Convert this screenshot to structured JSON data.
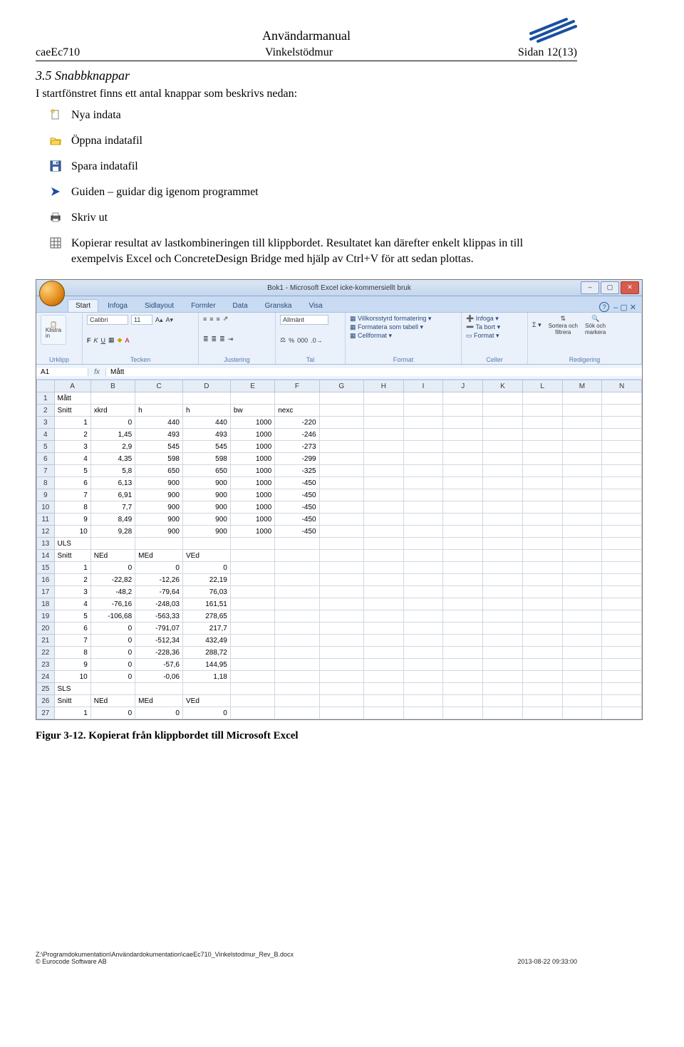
{
  "header": {
    "doc_title": "Användarmanual",
    "left": "caeEc710",
    "center": "Vinkelstödmur",
    "right": "Sidan 12(13)"
  },
  "section": {
    "heading": "3.5  Snabbknappar",
    "intro": "I startfönstret finns ett antal knappar som beskrivs nedan:",
    "items": [
      {
        "icon": "new-file-icon",
        "text": "Nya indata"
      },
      {
        "icon": "open-file-icon",
        "text": "Öppna indatafil"
      },
      {
        "icon": "save-icon",
        "text": "Spara indatafil"
      },
      {
        "icon": "guide-arrow-icon",
        "text": "Guiden – guidar dig igenom programmet"
      },
      {
        "icon": "print-icon",
        "text": "Skriv ut"
      },
      {
        "icon": "grid-icon",
        "text": "Kopierar resultat av lastkombineringen till klippbordet. Resultatet kan därefter enkelt klippas in till exempelvis Excel och ConcreteDesign Bridge med hjälp av Ctrl+V för att sedan plottas."
      }
    ]
  },
  "excel": {
    "title": "Bok1 - Microsoft Excel icke-kommersiellt bruk",
    "tabs": [
      "Start",
      "Infoga",
      "Sidlayout",
      "Formler",
      "Data",
      "Granska",
      "Visa"
    ],
    "active_tab": "Start",
    "ribbon": {
      "urklipp": {
        "label": "Urklipp",
        "paste": "Klistra\nin"
      },
      "tecken": {
        "label": "Tecken",
        "font": "Calibri",
        "size": "11"
      },
      "justering": {
        "label": "Justering"
      },
      "tal": {
        "label": "Tal",
        "format": "Allmänt"
      },
      "format": {
        "label": "Format",
        "items": [
          "Villkorsstyrd formatering",
          "Formatera som tabell",
          "Cellformat"
        ]
      },
      "celler": {
        "label": "Celler",
        "items": [
          "Infoga",
          "Ta bort",
          "Format"
        ]
      },
      "redigering": {
        "label": "Redigering",
        "sort": "Sortera och\nfiltrera",
        "find": "Sök och\nmarkera"
      }
    },
    "namebox": "A1",
    "formula": "Mått",
    "columns": [
      "A",
      "B",
      "C",
      "D",
      "E",
      "F",
      "G",
      "H",
      "I",
      "J",
      "K",
      "L",
      "M",
      "N"
    ],
    "rows": [
      {
        "n": 1,
        "cells": [
          "Mått",
          "",
          "",
          "",
          "",
          "",
          "",
          "",
          "",
          "",
          "",
          "",
          "",
          ""
        ],
        "txt": [
          0
        ]
      },
      {
        "n": 2,
        "cells": [
          "Snitt",
          "xkrd",
          "h",
          "h",
          "bw",
          "nexc",
          "",
          "",
          "",
          "",
          "",
          "",
          "",
          ""
        ],
        "txt": [
          0,
          1,
          2,
          3,
          4,
          5
        ]
      },
      {
        "n": 3,
        "cells": [
          "1",
          "0",
          "440",
          "440",
          "1000",
          "-220",
          "",
          "",
          "",
          "",
          "",
          "",
          "",
          ""
        ]
      },
      {
        "n": 4,
        "cells": [
          "2",
          "1,45",
          "493",
          "493",
          "1000",
          "-246",
          "",
          "",
          "",
          "",
          "",
          "",
          "",
          ""
        ]
      },
      {
        "n": 5,
        "cells": [
          "3",
          "2,9",
          "545",
          "545",
          "1000",
          "-273",
          "",
          "",
          "",
          "",
          "",
          "",
          "",
          ""
        ]
      },
      {
        "n": 6,
        "cells": [
          "4",
          "4,35",
          "598",
          "598",
          "1000",
          "-299",
          "",
          "",
          "",
          "",
          "",
          "",
          "",
          ""
        ]
      },
      {
        "n": 7,
        "cells": [
          "5",
          "5,8",
          "650",
          "650",
          "1000",
          "-325",
          "",
          "",
          "",
          "",
          "",
          "",
          "",
          ""
        ]
      },
      {
        "n": 8,
        "cells": [
          "6",
          "6,13",
          "900",
          "900",
          "1000",
          "-450",
          "",
          "",
          "",
          "",
          "",
          "",
          "",
          ""
        ]
      },
      {
        "n": 9,
        "cells": [
          "7",
          "6,91",
          "900",
          "900",
          "1000",
          "-450",
          "",
          "",
          "",
          "",
          "",
          "",
          "",
          ""
        ]
      },
      {
        "n": 10,
        "cells": [
          "8",
          "7,7",
          "900",
          "900",
          "1000",
          "-450",
          "",
          "",
          "",
          "",
          "",
          "",
          "",
          ""
        ]
      },
      {
        "n": 11,
        "cells": [
          "9",
          "8,49",
          "900",
          "900",
          "1000",
          "-450",
          "",
          "",
          "",
          "",
          "",
          "",
          "",
          ""
        ]
      },
      {
        "n": 12,
        "cells": [
          "10",
          "9,28",
          "900",
          "900",
          "1000",
          "-450",
          "",
          "",
          "",
          "",
          "",
          "",
          "",
          ""
        ]
      },
      {
        "n": 13,
        "cells": [
          "ULS",
          "",
          "",
          "",
          "",
          "",
          "",
          "",
          "",
          "",
          "",
          "",
          "",
          ""
        ],
        "txt": [
          0
        ]
      },
      {
        "n": 14,
        "cells": [
          "Snitt",
          "NEd",
          "MEd",
          "VEd",
          "",
          "",
          "",
          "",
          "",
          "",
          "",
          "",
          "",
          ""
        ],
        "txt": [
          0,
          1,
          2,
          3
        ]
      },
      {
        "n": 15,
        "cells": [
          "1",
          "0",
          "0",
          "0",
          "",
          "",
          "",
          "",
          "",
          "",
          "",
          "",
          "",
          ""
        ]
      },
      {
        "n": 16,
        "cells": [
          "2",
          "-22,82",
          "-12,26",
          "22,19",
          "",
          "",
          "",
          "",
          "",
          "",
          "",
          "",
          "",
          ""
        ]
      },
      {
        "n": 17,
        "cells": [
          "3",
          "-48,2",
          "-79,64",
          "76,03",
          "",
          "",
          "",
          "",
          "",
          "",
          "",
          "",
          "",
          ""
        ]
      },
      {
        "n": 18,
        "cells": [
          "4",
          "-76,16",
          "-248,03",
          "161,51",
          "",
          "",
          "",
          "",
          "",
          "",
          "",
          "",
          "",
          ""
        ]
      },
      {
        "n": 19,
        "cells": [
          "5",
          "-106,68",
          "-563,33",
          "278,65",
          "",
          "",
          "",
          "",
          "",
          "",
          "",
          "",
          "",
          ""
        ]
      },
      {
        "n": 20,
        "cells": [
          "6",
          "0",
          "-791,07",
          "217,7",
          "",
          "",
          "",
          "",
          "",
          "",
          "",
          "",
          "",
          ""
        ]
      },
      {
        "n": 21,
        "cells": [
          "7",
          "0",
          "-512,34",
          "432,49",
          "",
          "",
          "",
          "",
          "",
          "",
          "",
          "",
          "",
          ""
        ]
      },
      {
        "n": 22,
        "cells": [
          "8",
          "0",
          "-228,36",
          "288,72",
          "",
          "",
          "",
          "",
          "",
          "",
          "",
          "",
          "",
          ""
        ]
      },
      {
        "n": 23,
        "cells": [
          "9",
          "0",
          "-57,6",
          "144,95",
          "",
          "",
          "",
          "",
          "",
          "",
          "",
          "",
          "",
          ""
        ]
      },
      {
        "n": 24,
        "cells": [
          "10",
          "0",
          "-0,06",
          "1,18",
          "",
          "",
          "",
          "",
          "",
          "",
          "",
          "",
          "",
          ""
        ]
      },
      {
        "n": 25,
        "cells": [
          "SLS",
          "",
          "",
          "",
          "",
          "",
          "",
          "",
          "",
          "",
          "",
          "",
          "",
          ""
        ],
        "txt": [
          0
        ]
      },
      {
        "n": 26,
        "cells": [
          "Snitt",
          "NEd",
          "MEd",
          "VEd",
          "",
          "",
          "",
          "",
          "",
          "",
          "",
          "",
          "",
          ""
        ],
        "txt": [
          0,
          1,
          2,
          3
        ]
      },
      {
        "n": 27,
        "cells": [
          "1",
          "0",
          "0",
          "0",
          "",
          "",
          "",
          "",
          "",
          "",
          "",
          "",
          "",
          ""
        ]
      }
    ]
  },
  "figure_caption": "Figur 3-12. Kopierat från klippbordet till Microsoft Excel",
  "footer": {
    "path": "Z:\\Programdokumentation\\Användardokumentation\\caeEc710_Vinkelstodmur_Rev_B.docx",
    "copyright": "© Eurocode Software AB",
    "timestamp": "2013-08-22 09:33:00"
  }
}
